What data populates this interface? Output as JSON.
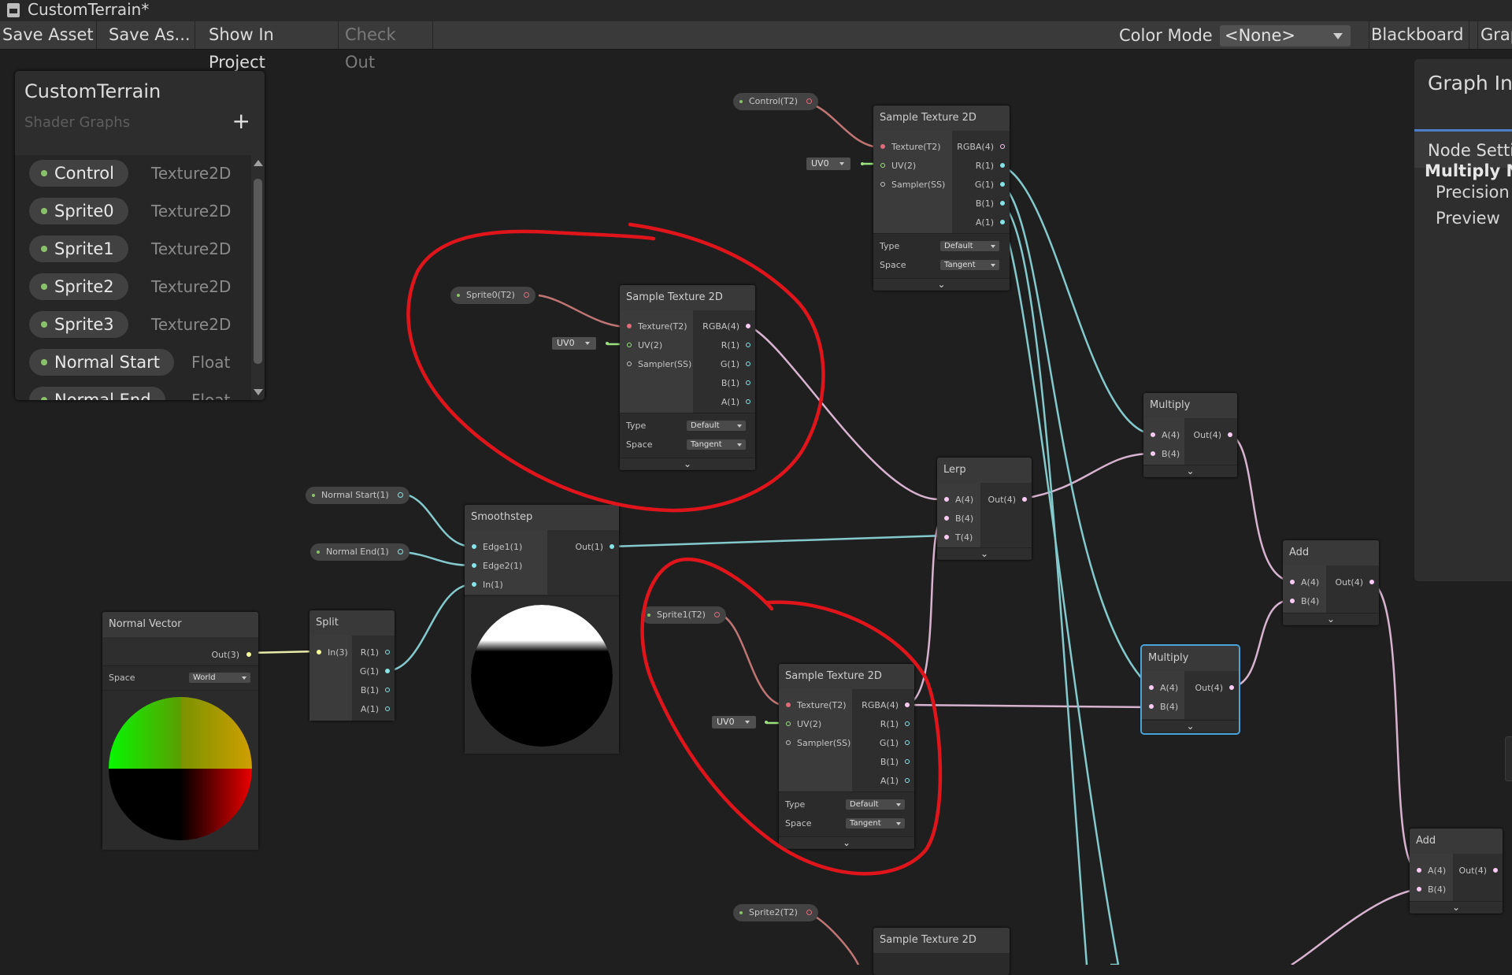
{
  "window": {
    "title": "CustomTerrain*",
    "icon": "shader-graph-icon"
  },
  "toolbar": {
    "save_asset": "Save Asset",
    "save_as": "Save As...",
    "show_in_project": "Show In Project",
    "check_out": "Check Out",
    "color_mode_label": "Color Mode",
    "color_mode_value": "<None>",
    "blackboard": "Blackboard",
    "graph_inspector": "Grap"
  },
  "blackboard": {
    "title": "CustomTerrain",
    "subtitle": "Shader Graphs",
    "add_icon": "plus-icon",
    "properties": [
      {
        "name": "Control",
        "type": "Texture2D"
      },
      {
        "name": "Sprite0",
        "type": "Texture2D"
      },
      {
        "name": "Sprite1",
        "type": "Texture2D"
      },
      {
        "name": "Sprite2",
        "type": "Texture2D"
      },
      {
        "name": "Sprite3",
        "type": "Texture2D"
      },
      {
        "name": "Normal Start",
        "type": "Float"
      },
      {
        "name": "Normal End",
        "type": "Float"
      }
    ]
  },
  "inspector": {
    "title": "Graph Ins",
    "tab": "Node Setti",
    "heading": "Multiply No",
    "items": [
      "Precision",
      "Preview"
    ]
  },
  "nodes": {
    "sample1": {
      "title": "Sample Texture 2D",
      "ins": [
        "Texture(T2)",
        "UV(2)",
        "Sampler(SS)"
      ],
      "outs": [
        "RGBA(4)",
        "R(1)",
        "G(1)",
        "B(1)",
        "A(1)"
      ],
      "type_label": "Type",
      "type_value": "Default",
      "space_label": "Space",
      "space_value": "Tangent"
    },
    "sample2": {
      "title": "Sample Texture 2D",
      "ins": [
        "Texture(T2)",
        "UV(2)",
        "Sampler(SS)"
      ],
      "outs": [
        "RGBA(4)",
        "R(1)",
        "G(1)",
        "B(1)",
        "A(1)"
      ],
      "type_label": "Type",
      "type_value": "Default",
      "space_label": "Space",
      "space_value": "Tangent"
    },
    "sample3": {
      "title": "Sample Texture 2D",
      "ins": [
        "Texture(T2)",
        "UV(2)",
        "Sampler(SS)"
      ],
      "outs": [
        "RGBA(4)",
        "R(1)",
        "G(1)",
        "B(1)",
        "A(1)"
      ],
      "type_label": "Type",
      "type_value": "Default",
      "space_label": "Space",
      "space_value": "Tangent"
    },
    "sample4": {
      "title": "Sample Texture 2D"
    },
    "smoothstep": {
      "title": "Smoothstep",
      "ins": [
        "Edge1(1)",
        "Edge2(1)",
        "In(1)"
      ],
      "outs": [
        "Out(1)"
      ]
    },
    "normalvector": {
      "title": "Normal Vector",
      "out": "Out(3)",
      "space_label": "Space",
      "space_value": "World"
    },
    "split": {
      "title": "Split",
      "in": "In(3)",
      "outs": [
        "R(1)",
        "G(1)",
        "B(1)",
        "A(1)"
      ]
    },
    "lerp": {
      "title": "Lerp",
      "ins": [
        "A(4)",
        "B(4)",
        "T(4)"
      ],
      "out": "Out(4)"
    },
    "multiply1": {
      "title": "Multiply",
      "ins": [
        "A(4)",
        "B(4)"
      ],
      "out": "Out(4)"
    },
    "multiply2": {
      "title": "Multiply",
      "ins": [
        "A(4)",
        "B(4)"
      ],
      "out": "Out(4)"
    },
    "add1": {
      "title": "Add",
      "ins": [
        "A(4)",
        "B(4)"
      ],
      "out": "Out(4)"
    },
    "add2": {
      "title": "Add",
      "ins": [
        "A(4)",
        "B(4)"
      ],
      "out": "Out(4)"
    }
  },
  "property_nodes": {
    "control": "Control(T2)",
    "sprite0": "Sprite0(T2)",
    "sprite1": "Sprite1(T2)",
    "sprite2": "Sprite2(T2)",
    "normal_start": "Normal Start(1)",
    "normal_end": "Normal End(1)"
  },
  "uv": "UV0",
  "colors": {
    "annotation": "#e0141b",
    "selected": "#4aa3d9",
    "texture_port": "#e06b7a",
    "vector1_port": "#84e4e7",
    "vector4_port": "#fbcbf4",
    "vector3_port": "#f6ff9a",
    "uv_port": "#9be27f"
  }
}
